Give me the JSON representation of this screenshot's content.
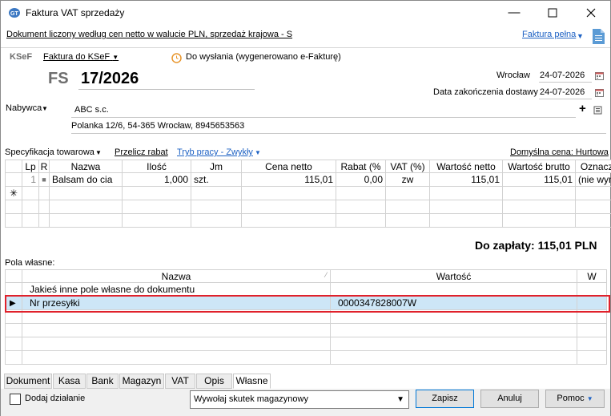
{
  "window": {
    "title": "Faktura VAT sprzedaży"
  },
  "info": {
    "doc_desc": "Dokument liczony według cen netto w walucie PLN, sprzedaż krajowa - S",
    "full_link": "Faktura pełna"
  },
  "ksef": {
    "label": "KSeF",
    "link": "Faktura do KSeF",
    "status": "Do wysłania (wygenerowano e-Fakturę)"
  },
  "doc": {
    "prefix": "FS",
    "number": "17/2026"
  },
  "place": {
    "label": "Wrocław",
    "date": "24-07-2026"
  },
  "delivery": {
    "label": "Data zakończenia dostawy",
    "date": "24-07-2026"
  },
  "buyer": {
    "label": "Nabywca",
    "name": "ABC s.c.",
    "address": "Polanka 12/6, 54-365 Wrocław, 8945653563"
  },
  "spec": {
    "label": "Specyfikacja towarowa",
    "recalc": "Przelicz rabat",
    "mode": "Tryb pracy - Zwykły",
    "default_price": "Domyślna cena: Hurtowa"
  },
  "items_table": {
    "headers": [
      "Lp",
      "R",
      "Nazwa",
      "Ilość",
      "Jm",
      "Cena netto",
      "Rabat (%",
      "VAT (%)",
      "Wartość netto",
      "Wartość brutto",
      "Oznacze"
    ],
    "rows": [
      {
        "lp": "1",
        "r": "■",
        "name": "Balsam do cia",
        "qty": "1,000",
        "unit": "szt.",
        "net_price": "115,01",
        "discount": "0,00",
        "vat": "zw",
        "net_value": "115,01",
        "gross_value": "115,01",
        "mark": "(nie wym"
      }
    ],
    "new_row_marker": "✳"
  },
  "summary": {
    "to_pay": "Do zapłaty: 115,01 PLN"
  },
  "custom_fields": {
    "label": "Pola własne:",
    "headers": [
      "Nazwa",
      "Wartość",
      "W"
    ],
    "rows": [
      {
        "name": "Jakieś inne pole własne do dokumentu",
        "value": ""
      },
      {
        "name": "Nr przesyłki",
        "value": "0000347828007W"
      }
    ]
  },
  "tabs": [
    "Dokument",
    "Kasa",
    "Bank",
    "Magazyn",
    "VAT",
    "Opis",
    "Własne"
  ],
  "footer": {
    "add_action": "Dodaj działanie",
    "select_value": "Wywołaj skutek magazynowy",
    "save": "Zapisz",
    "cancel": "Anuluj",
    "help": "Pomoc"
  },
  "colors": {
    "accent": "#1e62c4",
    "selection": "#cde6f7",
    "highlight": "#e0212b"
  }
}
